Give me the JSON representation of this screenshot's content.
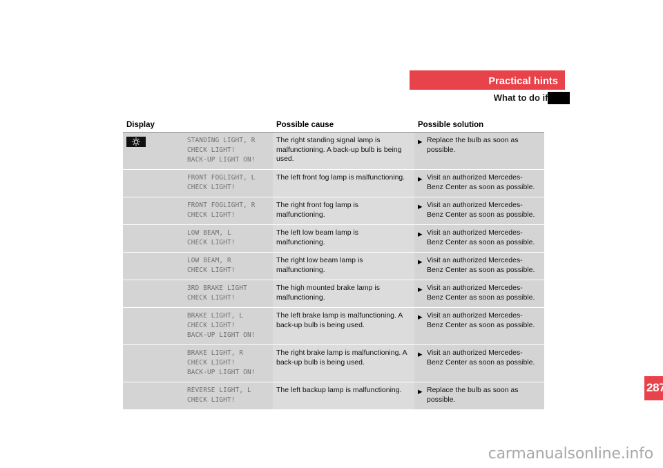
{
  "header": {
    "chapter_title": "Practical hints",
    "section_title": "What to do if …?",
    "chapter_bar_color": "#e8434a",
    "thumb_tab_color": "#000000"
  },
  "table": {
    "columns": [
      "Display",
      "Possible cause",
      "Possible solution"
    ],
    "rows": [
      {
        "icon": "standing-light-indicator-icon",
        "display": [
          "STANDING LIGHT, R",
          "CHECK LIGHT!",
          "BACK-UP LIGHT ON!"
        ],
        "cause": "The right standing signal lamp is malfunctioning. A back-up bulb is being used.",
        "solution": "Replace the bulb as soon as possible."
      },
      {
        "icon": "",
        "display": [
          "FRONT FOGLIGHT, L",
          "CHECK LIGHT!"
        ],
        "cause": "The left front fog lamp is malfunctioning.",
        "solution": "Visit an authorized Mercedes-Benz Center as soon as possible."
      },
      {
        "icon": "",
        "display": [
          "FRONT FOGLIGHT, R",
          "CHECK LIGHT!"
        ],
        "cause": "The right front fog lamp is malfunctioning.",
        "solution": "Visit an authorized Mercedes-Benz Center as soon as possible."
      },
      {
        "icon": "",
        "display": [
          "LOW BEAM, L",
          "CHECK LIGHT!"
        ],
        "cause": "The left low beam lamp is malfunctioning.",
        "solution": "Visit an authorized Mercedes-Benz Center as soon as possible."
      },
      {
        "icon": "",
        "display": [
          "LOW BEAM, R",
          "CHECK LIGHT!"
        ],
        "cause": "The right low beam lamp is malfunctioning.",
        "solution": "Visit an authorized Mercedes-Benz Center as soon as possible."
      },
      {
        "icon": "",
        "display": [
          "3RD BRAKE LIGHT",
          "CHECK LIGHT!"
        ],
        "cause": "The high mounted brake lamp is malfunctioning.",
        "solution": "Visit an authorized Mercedes-Benz Center as soon as possible."
      },
      {
        "icon": "",
        "display": [
          "BRAKE LIGHT, L",
          "CHECK LIGHT!",
          "BACK-UP LIGHT ON!"
        ],
        "cause": "The left brake lamp is malfunctioning. A back-up bulb is being used.",
        "solution": "Visit an authorized Mercedes-Benz Center as soon as possible."
      },
      {
        "icon": "",
        "display": [
          "BRAKE LIGHT, R",
          "CHECK LIGHT!",
          "BACK-UP LIGHT ON!"
        ],
        "cause": "The right brake lamp is malfunctioning. A back-up bulb is being used.",
        "solution": "Visit an authorized Mercedes-Benz Center as soon as possible."
      },
      {
        "icon": "",
        "display": [
          "REVERSE LIGHT, L",
          "CHECK LIGHT!"
        ],
        "cause": "The left backup lamp is malfunctioning.",
        "solution": "Replace the bulb as soon as possible."
      }
    ]
  },
  "footer": {
    "page_number": "287",
    "page_badge_color": "#e8434a",
    "watermark": "carmanualsonline.info"
  }
}
